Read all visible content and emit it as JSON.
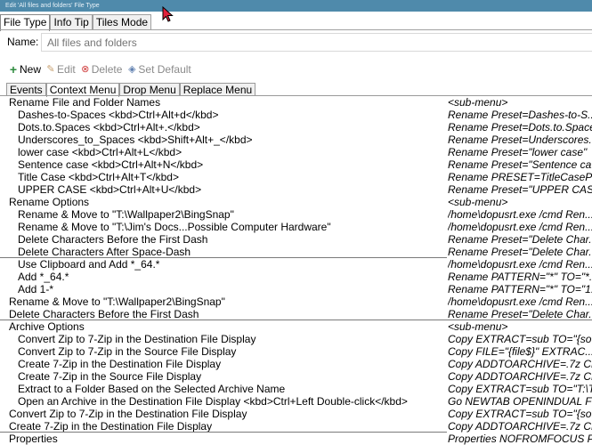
{
  "window": {
    "title": "Edit 'All files and folders' File Type"
  },
  "top_tabs": [
    {
      "label": "File Type",
      "active": true
    },
    {
      "label": "Info Tip",
      "active": false
    },
    {
      "label": "Tiles Mode",
      "active": false
    }
  ],
  "name_field": {
    "label": "Name:",
    "placeholder": "All files and folders"
  },
  "toolbar": {
    "new_label": "New",
    "edit_label": "Edit",
    "delete_label": "Delete",
    "set_default_label": "Set Default"
  },
  "sub_tabs": [
    {
      "label": "Events",
      "active": false
    },
    {
      "label": "Context Menu",
      "active": true
    },
    {
      "label": "Drop Menu",
      "active": false
    },
    {
      "label": "Replace Menu",
      "active": false
    }
  ],
  "menu_items": [
    {
      "label": "Rename File and Folder Names",
      "command": "<sub-menu>"
    },
    {
      "label": "Dashes-to-Spaces <kbd>Ctrl+Alt+d</kbd>",
      "command": "Rename Preset=Dashes-to-S..."
    },
    {
      "label": "Dots.to.Spaces <kbd>Ctrl+Alt+.</kbd>",
      "command": "Rename Preset=Dots.to.Spaces"
    },
    {
      "label": "Underscores_to_Spaces <kbd>Shift+Alt+_</kbd>",
      "command": "Rename Preset=Underscores..."
    },
    {
      "label": "lower case <kbd>Ctrl+Alt+L</kbd>",
      "command": "Rename Preset=\"lower case\""
    },
    {
      "label": "Sentence case <kbd>Ctrl+Alt+N</kbd>",
      "command": "Rename Preset=\"Sentence ca..."
    },
    {
      "label": "Title Case <kbd>Ctrl+Alt+T</kbd>",
      "command": "Rename PRESET=TitleCasePlus"
    },
    {
      "label": "UPPER CASE <kbd>Ctrl+Alt+U</kbd>",
      "command": "Rename Preset=\"UPPER CASE\""
    },
    {
      "label": "Rename Options",
      "command": "<sub-menu>"
    },
    {
      "label": "Rename & Move to \"T:\\Wallpaper2\\BingSnap\"",
      "command": "/home\\dopusrt.exe /cmd Ren..."
    },
    {
      "label": "Rename & Move to \"T:\\Jim's Docs...Possible Computer Hardware\"",
      "command": "/home\\dopusrt.exe /cmd Ren..."
    },
    {
      "label": "Delete Characters Before the First Dash",
      "command": "Rename Preset=\"Delete Char..."
    },
    {
      "label": "Delete Characters After Space-Dash",
      "command": "Rename Preset=\"Delete Char..."
    },
    {
      "label": "Use Clipboard and Add *_64.*",
      "command": "/home\\dopusrt.exe /cmd Ren..."
    },
    {
      "label": "Add *_64.*",
      "command": "Rename PATTERN=\"*\" TO=\"*..."
    },
    {
      "label": "Add 1-*",
      "command": "Rename PATTERN=\"*\" TO=\"1..."
    },
    {
      "label": "Rename & Move to \"T:\\Wallpaper2\\BingSnap\"",
      "command": "/home\\dopusrt.exe /cmd Ren..."
    },
    {
      "label": "Delete Characters Before the First Dash",
      "command": "Rename Preset=\"Delete Char..."
    },
    {
      "label": "Archive Options",
      "command": "<sub-menu>"
    },
    {
      "label": "Convert Zip to 7-Zip in the Destination File Display",
      "command": "Copy EXTRACT=sub TO=\"{so..."
    },
    {
      "label": "Convert Zip to 7-Zip in the Source File Display",
      "command": "Copy FILE=\"{file$}\" EXTRAC..."
    },
    {
      "label": "Create 7-Zip in the Destination File Display",
      "command": "Copy ADDTOARCHIVE=.7z CR..."
    },
    {
      "label": "Create 7-Zip in the Source File Display",
      "command": "Copy ADDTOARCHIVE=.7z CR..."
    },
    {
      "label": "Extract to a Folder Based on the Selected Archive Name",
      "command": "Copy EXTRACT=sub TO=\"T:\\T..."
    },
    {
      "label": "Open an Archive in the Destination File Display <kbd>Ctrl+Left Double-click</kbd>",
      "command": "Go NEWTAB OPENINDUAL FR..."
    },
    {
      "label": "Convert Zip to 7-Zip in the Destination File Display",
      "command": "Copy EXTRACT=sub TO=\"{so..."
    },
    {
      "label": "Create 7-Zip in the Destination File Display",
      "command": "Copy ADDTOARCHIVE=.7z CR..."
    },
    {
      "label": "Properties",
      "command": "Properties NOFROMFOCUS PO..."
    }
  ]
}
